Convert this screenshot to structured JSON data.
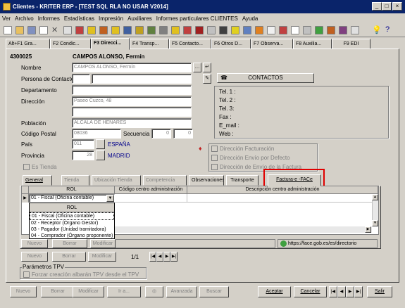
{
  "window": {
    "title": "Clientes - KRITER ERP - [TEST SQL RLA NO USAR V2014]"
  },
  "menu": [
    "Ver",
    "Archivo",
    "Informes",
    "Estadísticas",
    "Impresión",
    "Auxiliares",
    "Informes particulares CLIENTES",
    "Ayuda"
  ],
  "tabs": [
    "Alt+F1 Gra...",
    "F2 Condic...",
    "F3 Direcci...",
    "F4 Transp...",
    "F5 Contacto...",
    "F6 Otros D...",
    "F7 Observa...",
    "F8 Auxilia...",
    "F9 EDI"
  ],
  "client": {
    "code": "4300025",
    "name_header": "CAMPOS ALONSO, Fermín"
  },
  "labels": {
    "nombre": "Nombre",
    "persona": "Persona de Contacto",
    "departamento": "Departamento",
    "direccion": "Dirección",
    "poblacion": "Población",
    "cp": "Código Postal",
    "secuencia": "Secuencia",
    "pais": "País",
    "provincia": "Provincia",
    "es_tienda": "Es Tienda",
    "tel1": "Tel. 1 :",
    "tel2": "Tel. 2 :",
    "tel3": "Tel. 3:",
    "fax": "Fax :",
    "email": "E_mail :",
    "web": "Web :",
    "parametros_tpv": "Parámetros TPV",
    "forzar_tpv": "Forzar creación albarán TPV desde el TPV"
  },
  "fields": {
    "nombre": "CAMPOS ALONSO, Fermín",
    "direccion": "Paseo Cuzco, 48",
    "poblacion": "ALCALÁ DE HENARES",
    "cp": "08036",
    "secuencia1": "0",
    "secuencia2": "0",
    "pais_code": "011",
    "pais_name": "ESPAÑA",
    "provincia_code": "28",
    "provincia_name": "MADRID"
  },
  "contactos_button": "CONTACTOS",
  "direccion_checks": [
    "Dirección Facturación",
    "Dirección Envío por Defecto",
    "Dirección de Envío de la Factura"
  ],
  "subtabs": [
    "General",
    "Tienda",
    "Ubicación Tienda",
    "Competencia",
    "Observaciones",
    "Transporte",
    "Factura-e -FACe"
  ],
  "grid": {
    "col_rol": "ROL",
    "col_codigo": "Código centro administración",
    "col_desc": "Descripción centro administración",
    "row_value": "01 - Fiscal (Oficina contable)",
    "dropdown_header": "ROL",
    "dropdown_options": [
      "01 - Fiscal (Oficina contable)",
      "02 - Receptor (Órgano Gestor)",
      "03 - Pagador (Unidad tramitadora)",
      "04 - Comprador (Órgano proponente)"
    ]
  },
  "status_url": "https://face.gob.es/es/directorio",
  "inner_buttons": {
    "nuevo": "Nuevo",
    "borrar": "Borrar",
    "modificar": "Modificar"
  },
  "record_counter": "1/1",
  "bottom_buttons": {
    "nuevo": "Nuevo",
    "borrar": "Borrar",
    "modificar": "Modificar",
    "ir": "Ir a...",
    "avanzada": "Avanzada",
    "buscar": "Buscar",
    "aceptar": "Aceptar",
    "cancelar": "Cancelar",
    "salir": "Salir"
  },
  "colors": {
    "titlebar": "#0a246a",
    "highlight_rect": "#e00000",
    "link_blue": "#00008b"
  }
}
